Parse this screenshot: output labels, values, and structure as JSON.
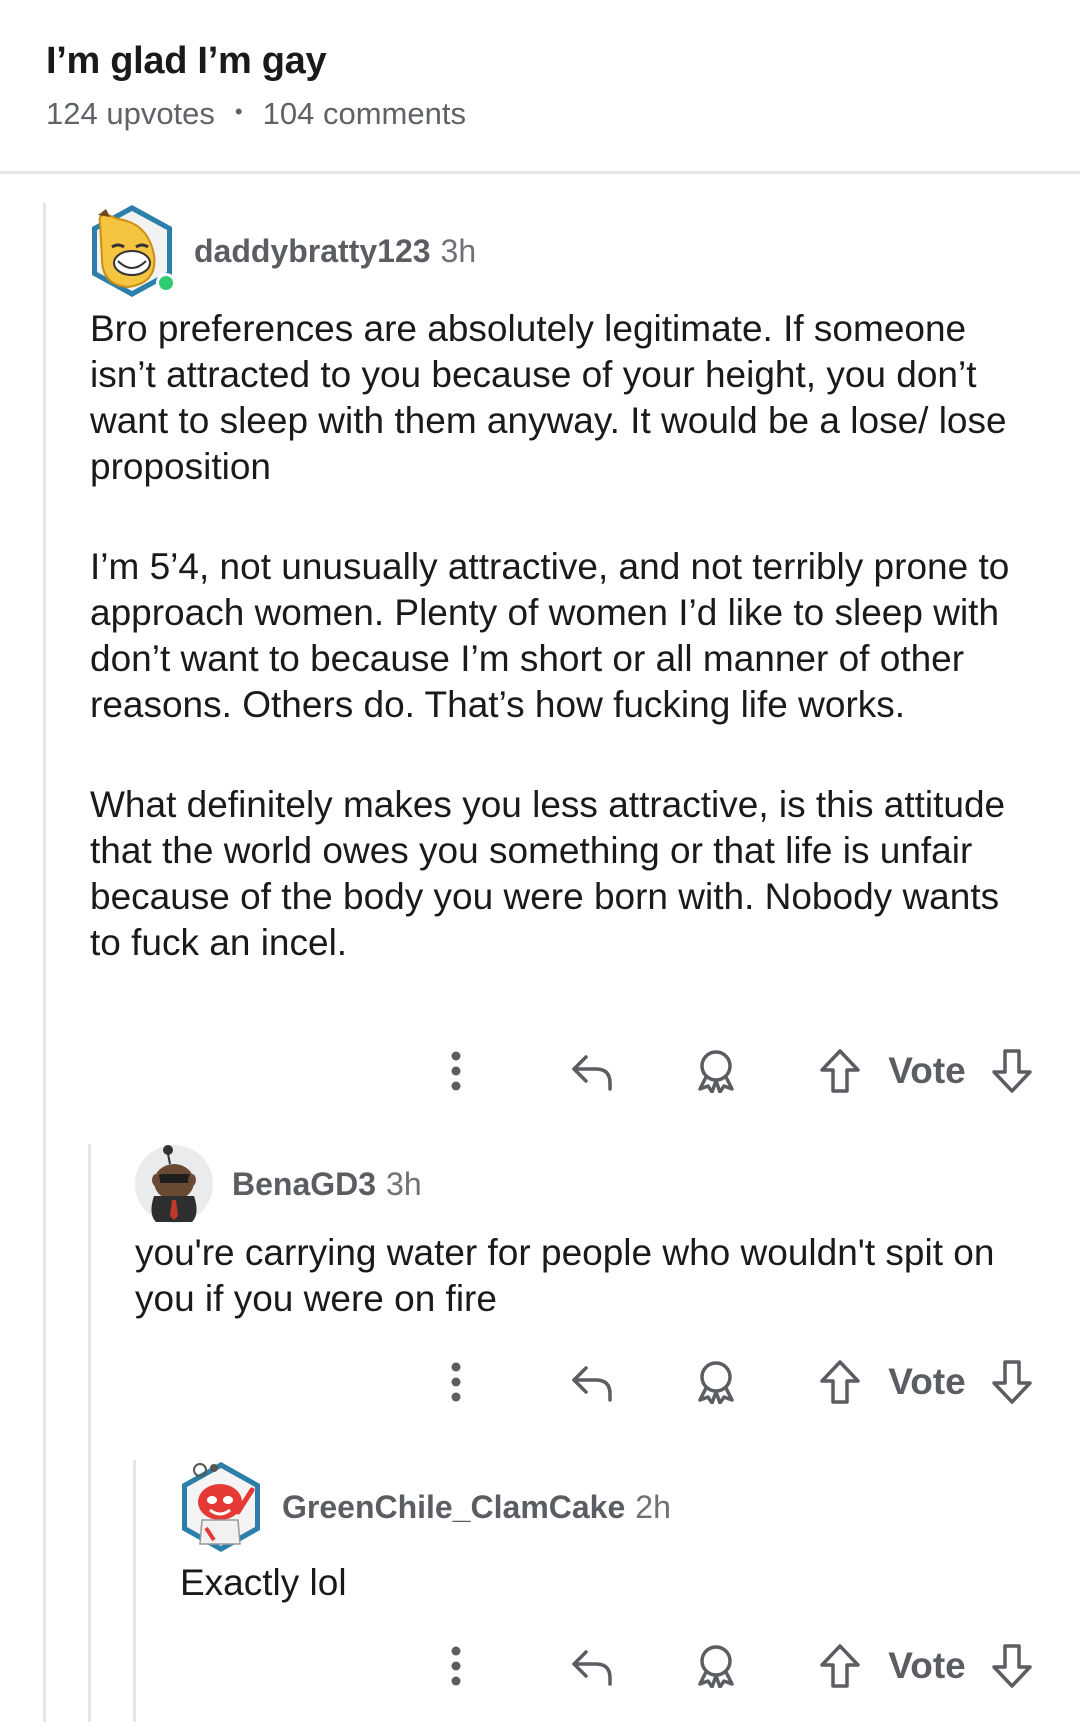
{
  "post": {
    "title": "I’m glad I’m gay",
    "upvotes": "124 upvotes",
    "separator": "•",
    "comments": "104 comments"
  },
  "comments": [
    {
      "username": "daddybratty123",
      "time": "3h",
      "paragraphs": [
        "Bro preferences are absolutely legitimate. If someone isn’t attracted to you because of your height, you don’t want to sleep with them anyway. It would be a lose/ lose proposition",
        "I’m 5’4, not unusually attractive, and not terribly prone to approach women. Plenty of women I’d like to sleep with don’t want to because I’m short or all manner of other reasons. Others do. That’s how fucking life works.",
        "What definitely makes you less attractive, is this attitude that the world owes you something or that life is unfair because of the body you were born with. Nobody wants to fuck an incel."
      ],
      "vote_label": "Vote",
      "online": true
    },
    {
      "username": "BenaGD3",
      "time": "3h",
      "paragraphs": [
        "you're carrying water for people who wouldn't spit on you if you were on fire"
      ],
      "vote_label": "Vote"
    },
    {
      "username": "GreenChile_ClamCake",
      "time": "2h",
      "paragraphs": [
        "Exactly lol"
      ],
      "vote_label": "Vote"
    }
  ],
  "icons": {
    "more": "more-options-icon",
    "reply": "reply-icon",
    "award": "award-icon",
    "upvote": "upvote-arrow-icon",
    "downvote": "downvote-arrow-icon"
  },
  "colors": {
    "text": "#1a1a1b",
    "meta": "#5f6368",
    "icon": "#5a5d61",
    "thread_line": "#e4e6e8",
    "online": "#2ecc71"
  }
}
